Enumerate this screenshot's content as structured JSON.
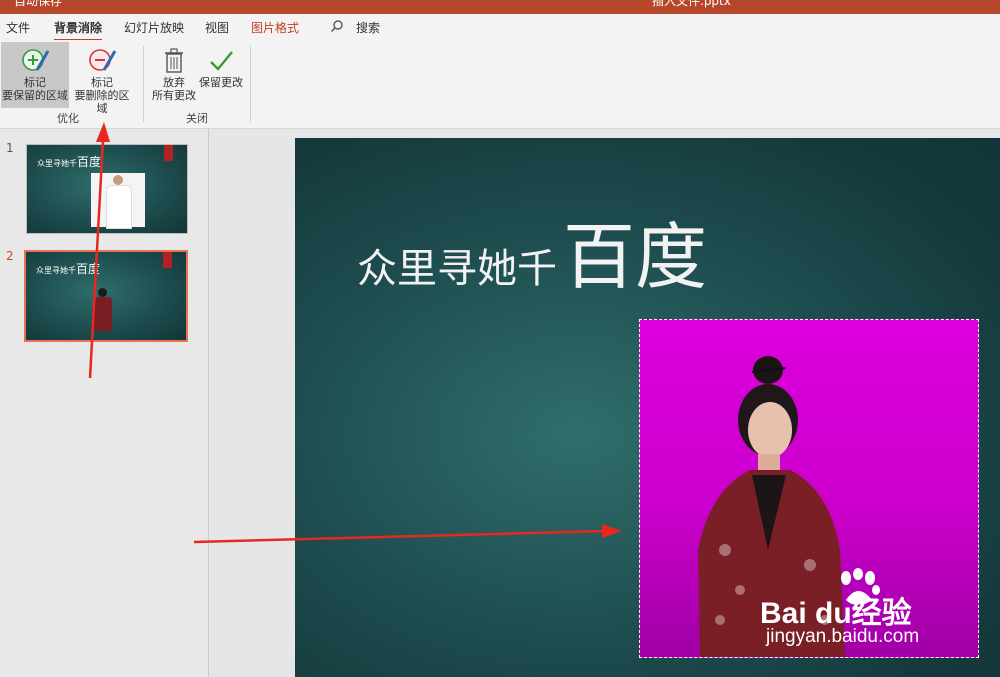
{
  "window": {
    "autosave_label": "自动保存",
    "filename": "插入文件.pptx"
  },
  "tabs": [
    {
      "label": "文件"
    },
    {
      "label": "背景消除"
    },
    {
      "label": "幻灯片放映"
    },
    {
      "label": "视图"
    },
    {
      "label": "图片格式"
    }
  ],
  "search": {
    "label": "搜索"
  },
  "ribbon": {
    "mark_keep": {
      "line1": "标记",
      "line2": "要保留的区域"
    },
    "mark_remove": {
      "line1": "标记",
      "line2": "要删除的区域"
    },
    "group_refine": "优化",
    "discard": {
      "line1": "放弃",
      "line2": "所有更改"
    },
    "keep_changes": {
      "line1": "保留更改"
    },
    "group_close": "关闭"
  },
  "slides": [
    {
      "number": "1",
      "title_small": "众里寻她千",
      "title_big": "百度"
    },
    {
      "number": "2",
      "title_small": "众里寻她千",
      "title_big": "百度"
    }
  ],
  "slide": {
    "title_small": "众里寻她千",
    "title_big": "百度"
  },
  "watermark": {
    "brand": "Bai du",
    "cn": "经验",
    "url": "jingyan.baidu.com"
  },
  "colors": {
    "accent": "#b7472a",
    "removal_magenta": "#dd00dd",
    "annotation_arrow": "#e8281e"
  }
}
